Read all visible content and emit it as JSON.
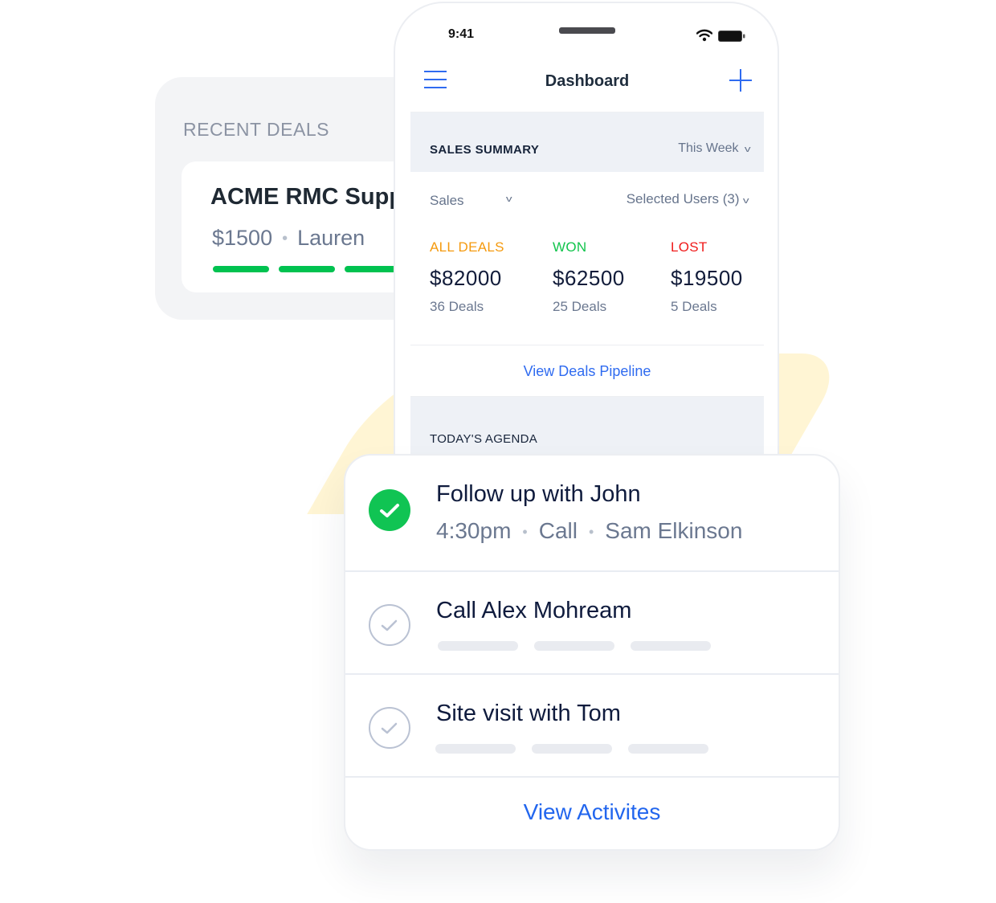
{
  "recent_deals": {
    "title": "RECENT DEALS",
    "deal": {
      "name": "ACME RMC Supplies",
      "amount": "$1500",
      "owner": "Lauren",
      "separator": "•",
      "progress_steps_filled": 3,
      "accent": "#00c250"
    }
  },
  "phone": {
    "status_bar": {
      "time": "9:41",
      "icons": [
        "wifi-icon",
        "battery-icon"
      ]
    },
    "nav": {
      "menu_icon": "hamburger-menu-icon",
      "title": "Dashboard",
      "add_icon": "plus-icon"
    },
    "sales_summary": {
      "label": "SALES SUMMARY",
      "period": "This Week",
      "pipeline_filter": "Sales",
      "users_filter": "Selected Users (3)",
      "stats": [
        {
          "label": "ALL DEALS",
          "value": "$82000",
          "count": "36 Deals",
          "color": "#f59a0e"
        },
        {
          "label": "WON",
          "value": "$62500",
          "count": "25 Deals",
          "color": "#12c44c"
        },
        {
          "label": "LOST",
          "value": "$19500",
          "count": "5 Deals",
          "color": "#f01b1b"
        }
      ],
      "pipeline_link": "View Deals Pipeline"
    },
    "agenda": {
      "label": "TODAY'S AGENDA"
    }
  },
  "agenda_card": {
    "tasks": [
      {
        "title": "Follow up with John",
        "done": true,
        "time": "4:30pm",
        "type": "Call",
        "person": "Sam Elkinson",
        "separator": "•"
      },
      {
        "title": "Call Alex Mohream",
        "done": false
      },
      {
        "title": "Site visit with Tom",
        "done": false
      }
    ],
    "view_link": "View Activites"
  },
  "colors": {
    "brand_blue": "#2f6bf0",
    "success_green": "#10c453",
    "text_dark": "#0f1b3d",
    "text_muted": "#6b7890"
  }
}
